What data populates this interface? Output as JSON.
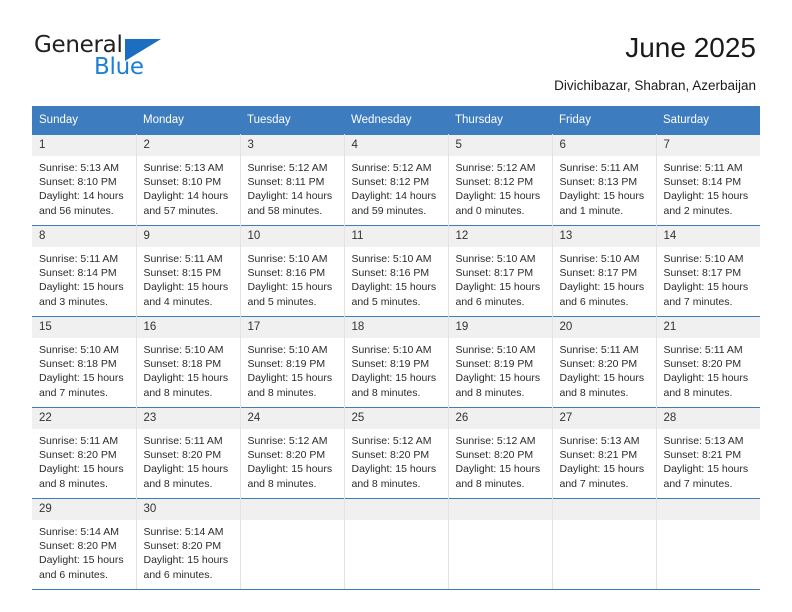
{
  "brand": {
    "name_top": "General",
    "name_bottom": "Blue",
    "triangle_color": "#1c6fc0",
    "blue_color": "#1c7fd6"
  },
  "header": {
    "title": "June 2025",
    "subtitle": "Divichibazar, Shabran, Azerbaijan"
  },
  "theme": {
    "header_bg": "#3c7cbf",
    "header_text": "#ffffff",
    "daynum_bg": "#f0f0f0",
    "cell_bg": "#ffffff",
    "rule_color": "#3c7cbf"
  },
  "columns": [
    "Sunday",
    "Monday",
    "Tuesday",
    "Wednesday",
    "Thursday",
    "Friday",
    "Saturday"
  ],
  "weeks": [
    [
      {
        "day": "1",
        "sunrise": "Sunrise: 5:13 AM",
        "sunset": "Sunset: 8:10 PM",
        "daylight": "Daylight: 14 hours and 56 minutes."
      },
      {
        "day": "2",
        "sunrise": "Sunrise: 5:13 AM",
        "sunset": "Sunset: 8:10 PM",
        "daylight": "Daylight: 14 hours and 57 minutes."
      },
      {
        "day": "3",
        "sunrise": "Sunrise: 5:12 AM",
        "sunset": "Sunset: 8:11 PM",
        "daylight": "Daylight: 14 hours and 58 minutes."
      },
      {
        "day": "4",
        "sunrise": "Sunrise: 5:12 AM",
        "sunset": "Sunset: 8:12 PM",
        "daylight": "Daylight: 14 hours and 59 minutes."
      },
      {
        "day": "5",
        "sunrise": "Sunrise: 5:12 AM",
        "sunset": "Sunset: 8:12 PM",
        "daylight": "Daylight: 15 hours and 0 minutes."
      },
      {
        "day": "6",
        "sunrise": "Sunrise: 5:11 AM",
        "sunset": "Sunset: 8:13 PM",
        "daylight": "Daylight: 15 hours and 1 minute."
      },
      {
        "day": "7",
        "sunrise": "Sunrise: 5:11 AM",
        "sunset": "Sunset: 8:14 PM",
        "daylight": "Daylight: 15 hours and 2 minutes."
      }
    ],
    [
      {
        "day": "8",
        "sunrise": "Sunrise: 5:11 AM",
        "sunset": "Sunset: 8:14 PM",
        "daylight": "Daylight: 15 hours and 3 minutes."
      },
      {
        "day": "9",
        "sunrise": "Sunrise: 5:11 AM",
        "sunset": "Sunset: 8:15 PM",
        "daylight": "Daylight: 15 hours and 4 minutes."
      },
      {
        "day": "10",
        "sunrise": "Sunrise: 5:10 AM",
        "sunset": "Sunset: 8:16 PM",
        "daylight": "Daylight: 15 hours and 5 minutes."
      },
      {
        "day": "11",
        "sunrise": "Sunrise: 5:10 AM",
        "sunset": "Sunset: 8:16 PM",
        "daylight": "Daylight: 15 hours and 5 minutes."
      },
      {
        "day": "12",
        "sunrise": "Sunrise: 5:10 AM",
        "sunset": "Sunset: 8:17 PM",
        "daylight": "Daylight: 15 hours and 6 minutes."
      },
      {
        "day": "13",
        "sunrise": "Sunrise: 5:10 AM",
        "sunset": "Sunset: 8:17 PM",
        "daylight": "Daylight: 15 hours and 6 minutes."
      },
      {
        "day": "14",
        "sunrise": "Sunrise: 5:10 AM",
        "sunset": "Sunset: 8:17 PM",
        "daylight": "Daylight: 15 hours and 7 minutes."
      }
    ],
    [
      {
        "day": "15",
        "sunrise": "Sunrise: 5:10 AM",
        "sunset": "Sunset: 8:18 PM",
        "daylight": "Daylight: 15 hours and 7 minutes."
      },
      {
        "day": "16",
        "sunrise": "Sunrise: 5:10 AM",
        "sunset": "Sunset: 8:18 PM",
        "daylight": "Daylight: 15 hours and 8 minutes."
      },
      {
        "day": "17",
        "sunrise": "Sunrise: 5:10 AM",
        "sunset": "Sunset: 8:19 PM",
        "daylight": "Daylight: 15 hours and 8 minutes."
      },
      {
        "day": "18",
        "sunrise": "Sunrise: 5:10 AM",
        "sunset": "Sunset: 8:19 PM",
        "daylight": "Daylight: 15 hours and 8 minutes."
      },
      {
        "day": "19",
        "sunrise": "Sunrise: 5:10 AM",
        "sunset": "Sunset: 8:19 PM",
        "daylight": "Daylight: 15 hours and 8 minutes."
      },
      {
        "day": "20",
        "sunrise": "Sunrise: 5:11 AM",
        "sunset": "Sunset: 8:20 PM",
        "daylight": "Daylight: 15 hours and 8 minutes."
      },
      {
        "day": "21",
        "sunrise": "Sunrise: 5:11 AM",
        "sunset": "Sunset: 8:20 PM",
        "daylight": "Daylight: 15 hours and 8 minutes."
      }
    ],
    [
      {
        "day": "22",
        "sunrise": "Sunrise: 5:11 AM",
        "sunset": "Sunset: 8:20 PM",
        "daylight": "Daylight: 15 hours and 8 minutes."
      },
      {
        "day": "23",
        "sunrise": "Sunrise: 5:11 AM",
        "sunset": "Sunset: 8:20 PM",
        "daylight": "Daylight: 15 hours and 8 minutes."
      },
      {
        "day": "24",
        "sunrise": "Sunrise: 5:12 AM",
        "sunset": "Sunset: 8:20 PM",
        "daylight": "Daylight: 15 hours and 8 minutes."
      },
      {
        "day": "25",
        "sunrise": "Sunrise: 5:12 AM",
        "sunset": "Sunset: 8:20 PM",
        "daylight": "Daylight: 15 hours and 8 minutes."
      },
      {
        "day": "26",
        "sunrise": "Sunrise: 5:12 AM",
        "sunset": "Sunset: 8:20 PM",
        "daylight": "Daylight: 15 hours and 8 minutes."
      },
      {
        "day": "27",
        "sunrise": "Sunrise: 5:13 AM",
        "sunset": "Sunset: 8:21 PM",
        "daylight": "Daylight: 15 hours and 7 minutes."
      },
      {
        "day": "28",
        "sunrise": "Sunrise: 5:13 AM",
        "sunset": "Sunset: 8:21 PM",
        "daylight": "Daylight: 15 hours and 7 minutes."
      }
    ],
    [
      {
        "day": "29",
        "sunrise": "Sunrise: 5:14 AM",
        "sunset": "Sunset: 8:20 PM",
        "daylight": "Daylight: 15 hours and 6 minutes."
      },
      {
        "day": "30",
        "sunrise": "Sunrise: 5:14 AM",
        "sunset": "Sunset: 8:20 PM",
        "daylight": "Daylight: 15 hours and 6 minutes."
      },
      {
        "day": "",
        "sunrise": "",
        "sunset": "",
        "daylight": ""
      },
      {
        "day": "",
        "sunrise": "",
        "sunset": "",
        "daylight": ""
      },
      {
        "day": "",
        "sunrise": "",
        "sunset": "",
        "daylight": ""
      },
      {
        "day": "",
        "sunrise": "",
        "sunset": "",
        "daylight": ""
      },
      {
        "day": "",
        "sunrise": "",
        "sunset": "",
        "daylight": ""
      }
    ]
  ]
}
